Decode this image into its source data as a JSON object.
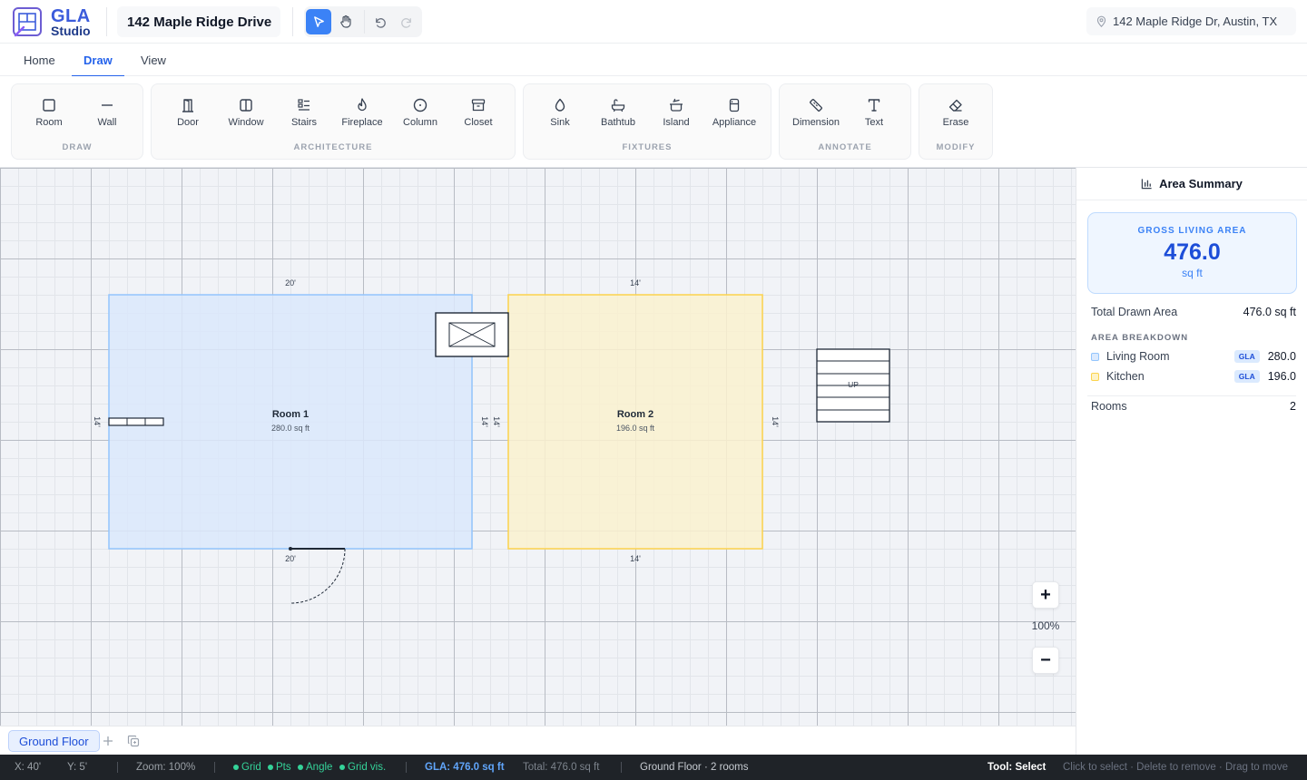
{
  "app": {
    "logo_line1": "GLA",
    "logo_line2": "Studio",
    "project_name": "142 Maple Ridge Drive",
    "address": "142 Maple Ridge Dr, Austin, TX"
  },
  "toolbar": {
    "select_icon": "pointer-icon",
    "pan_icon": "hand-icon",
    "undo_icon": "undo-icon",
    "redo_icon": "redo-icon",
    "active_tool": "select"
  },
  "tabs": [
    {
      "label": "Home",
      "active": false
    },
    {
      "label": "Draw",
      "active": true
    },
    {
      "label": "View",
      "active": false
    }
  ],
  "ribbon": {
    "groups": [
      {
        "label": "DRAW",
        "items": [
          {
            "label": "Room",
            "icon": "square-icon"
          },
          {
            "label": "Wall",
            "icon": "line-icon"
          }
        ]
      },
      {
        "label": "ARCHITECTURE",
        "items": [
          {
            "label": "Door",
            "icon": "door-icon"
          },
          {
            "label": "Window",
            "icon": "window-icon"
          },
          {
            "label": "Stairs",
            "icon": "stairs-icon"
          },
          {
            "label": "Fireplace",
            "icon": "flame-icon"
          },
          {
            "label": "Column",
            "icon": "circle-icon"
          },
          {
            "label": "Closet",
            "icon": "archive-icon"
          }
        ]
      },
      {
        "label": "FIXTURES",
        "items": [
          {
            "label": "Sink",
            "icon": "droplet-icon"
          },
          {
            "label": "Bathtub",
            "icon": "bath-icon"
          },
          {
            "label": "Island",
            "icon": "cooking-pot-icon"
          },
          {
            "label": "Appliance",
            "icon": "refrigerator-icon"
          }
        ]
      },
      {
        "label": "ANNOTATE",
        "items": [
          {
            "label": "Dimension",
            "icon": "ruler-icon"
          },
          {
            "label": "Text",
            "icon": "type-icon"
          }
        ]
      },
      {
        "label": "MODIFY",
        "items": [
          {
            "label": "Erase",
            "icon": "eraser-icon"
          }
        ]
      }
    ]
  },
  "canvas": {
    "rooms": [
      {
        "name": "Room 1",
        "area": "280.0 sq ft",
        "width_label": "20'",
        "height_label": "14'",
        "fill": "#dbe8fb",
        "stroke": "#93c5fd"
      },
      {
        "name": "Room 2",
        "area": "196.0 sq ft",
        "width_label": "14'",
        "height_label": "14'",
        "fill": "#faf1cf",
        "stroke": "#fcd34d"
      }
    ],
    "stairs_label": "UP",
    "zoom": {
      "in": "+",
      "level": "100%",
      "out": "−"
    }
  },
  "floors": {
    "active": "Ground Floor",
    "add_icon": "plus-icon",
    "duplicate_icon": "copy-icon"
  },
  "summary": {
    "title": "Area Summary",
    "gla_caption": "GROSS LIVING AREA",
    "gla_value": "476.0",
    "gla_unit": "sq ft",
    "total_label": "Total Drawn Area",
    "total_value": "476.0 sq ft",
    "breakdown_caption": "AREA BREAKDOWN",
    "breakdown": [
      {
        "name": "Living Room",
        "tag": "GLA",
        "value": "280.0",
        "color": "#dbeafe",
        "border": "#93c5fd"
      },
      {
        "name": "Kitchen",
        "tag": "GLA",
        "value": "196.0",
        "color": "#fef3c7",
        "border": "#fcd34d"
      }
    ],
    "rooms_label": "Rooms",
    "rooms_value": "2"
  },
  "status": {
    "x": "X: 40'",
    "y": "Y: 5'",
    "zoom": "Zoom: 100%",
    "toggles": [
      "Grid",
      "Pts",
      "Angle",
      "Grid vis."
    ],
    "gla": "GLA: 476.0 sq ft",
    "total": "Total: 476.0 sq ft",
    "floor": "Ground Floor · 2 rooms",
    "tool": "Tool: Select",
    "hint": "Click to select · Delete to remove · Drag to move"
  }
}
